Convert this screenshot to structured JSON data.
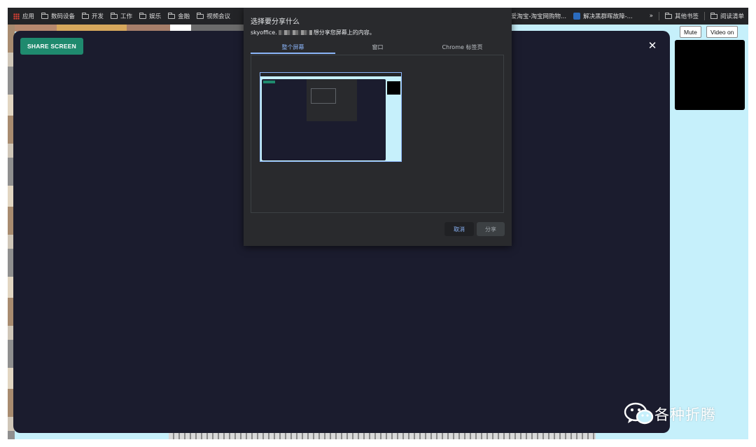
{
  "bookmarks": {
    "left": [
      {
        "label": "应用",
        "icon": "apps-grid-icon"
      },
      {
        "label": "数码设备",
        "icon": "folder-icon"
      },
      {
        "label": "开发",
        "icon": "folder-icon"
      },
      {
        "label": "工作",
        "icon": "folder-icon"
      },
      {
        "label": "娱乐",
        "icon": "folder-icon"
      },
      {
        "label": "金融",
        "icon": "folder-icon"
      },
      {
        "label": "视频会议",
        "icon": "folder-icon"
      }
    ],
    "right": {
      "taobao": "爱淘宝-淘宝网购物...",
      "blog": "解决黑群晖故障-...",
      "overflow": "»",
      "other": "其他书签",
      "reading": "阅读清单"
    }
  },
  "app": {
    "share_button": "SHARE SCREEN",
    "close": "✕",
    "mute_button": "Mute",
    "video_button": "Video on"
  },
  "dialog": {
    "title": "选择要分享什么",
    "subtitle_prefix": "skyoffice.",
    "subtitle_suffix": "想分享您屏幕上的内容。",
    "tabs": [
      {
        "label": "整个屏幕",
        "active": true
      },
      {
        "label": "窗口",
        "active": false
      },
      {
        "label": "Chrome 标签页",
        "active": false
      }
    ],
    "cancel": "取消",
    "share": "分享"
  },
  "watermark": {
    "text": "各种折腾",
    "icon": "wechat-icon"
  },
  "colors": {
    "accent": "#8ab4f8",
    "share_green": "#1f8a6e",
    "panel": "#1b1c2e",
    "dialog": "#292a2d",
    "map_bg": "#c6f0fb"
  }
}
